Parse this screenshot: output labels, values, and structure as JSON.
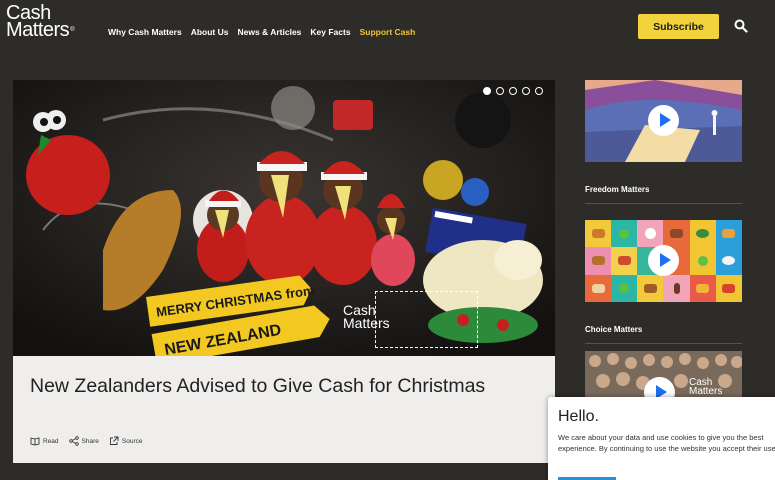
{
  "header": {
    "logo": {
      "line1": "Cash",
      "line2": "Matters",
      "mark": "®"
    },
    "nav": [
      {
        "label": "Why Cash Matters"
      },
      {
        "label": "About Us"
      },
      {
        "label": "News & Articles"
      },
      {
        "label": "Key Facts"
      },
      {
        "label": "Support Cash",
        "accent": true
      }
    ],
    "subscribe_label": "Subscribe",
    "search_icon": "search-icon"
  },
  "hero": {
    "slides": 5,
    "active_slide": 1,
    "sign_top": "MERRY CHRISTMAS from",
    "sign_bottom": "NEW ZEALAND",
    "brand_line1": "Cash",
    "brand_line2": "Matters"
  },
  "article": {
    "title": "New Zealanders Advised to Give Cash for Christmas",
    "actions": [
      {
        "icon": "book-icon",
        "label": "Read"
      },
      {
        "icon": "share-icon",
        "label": "Share"
      },
      {
        "icon": "external-link-icon",
        "label": "Source"
      }
    ]
  },
  "sidebar": {
    "items": [
      {
        "label": "Freedom Matters",
        "icon": "play-icon"
      },
      {
        "label": "Choice Matters",
        "icon": "play-icon"
      },
      {
        "label": "",
        "icon": "play-icon",
        "brand_line1": "Cash",
        "brand_line2": "Matters"
      }
    ]
  },
  "cookie": {
    "title": "Hello.",
    "text": "We care about your data and use cookies to give you the best experience. By continuing to use the website you accept their use."
  },
  "colors": {
    "background": "#2e2c28",
    "accent": "#f2c531",
    "subscribe": "#f2d33b",
    "play": "#1e6ff2"
  }
}
